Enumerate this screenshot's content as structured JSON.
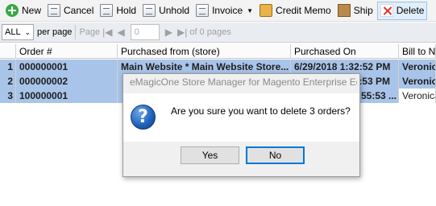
{
  "toolbar": {
    "new": "New",
    "cancel": "Cancel",
    "hold": "Hold",
    "unhold": "Unhold",
    "invoice": "Invoice",
    "credit_memo": "Credit Memo",
    "ship": "Ship",
    "delete": "Delete"
  },
  "pager": {
    "page_size": "ALL",
    "per_page_label": "per page",
    "page_label": "Page",
    "page_value": "0",
    "of_pages": "of 0 pages"
  },
  "grid": {
    "headers": [
      "",
      "Order #",
      "Purchased from (store)",
      "Purchased On",
      "Bill to Nan"
    ],
    "rows": [
      [
        "1",
        "000000001",
        "Main Website * Main Website Store...",
        "6/29/2018 1:32:52 PM",
        "Veronic"
      ],
      [
        "2",
        "000000002",
        "",
        "2:53 PM",
        "Veronic"
      ],
      [
        "3",
        "100000001",
        "",
        "55:53 ...",
        "Veronica"
      ]
    ]
  },
  "dialog": {
    "title": "eMagicOne Store Manager for Magento Enterprise Ed...",
    "message": "Are you sure you want to delete 3 orders?",
    "yes": "Yes",
    "no": "No"
  }
}
